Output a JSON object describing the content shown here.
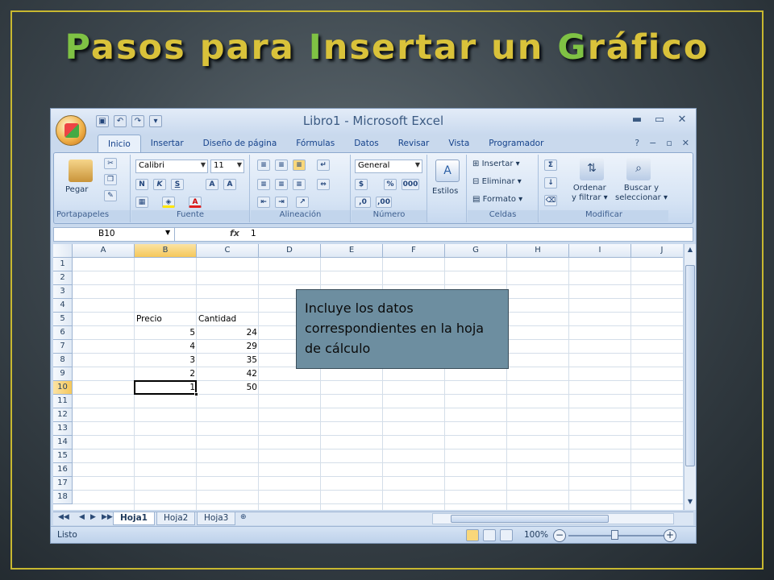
{
  "slide": {
    "title": "Pasos para Insertar un Gráfico",
    "callout": "Incluye los datos correspondientes en la hoja de cálculo"
  },
  "excel": {
    "window_title": "Libro1 - Microsoft Excel",
    "tabs": [
      "Inicio",
      "Insertar",
      "Diseño de página",
      "Fórmulas",
      "Datos",
      "Revisar",
      "Vista",
      "Programador"
    ],
    "active_tab": "Inicio",
    "ribbon": {
      "portapapeles": {
        "label": "Portapapeles",
        "pegar": "Pegar"
      },
      "fuente": {
        "label": "Fuente",
        "font": "Calibri",
        "size": "11"
      },
      "alineacion": {
        "label": "Alineación"
      },
      "numero": {
        "label": "Número",
        "format": "General"
      },
      "estilos": {
        "label": "Estilos"
      },
      "celdas": {
        "label": "Celdas",
        "insertar": "Insertar",
        "eliminar": "Eliminar",
        "formato": "Formato"
      },
      "modificar": {
        "label": "Modificar",
        "ordenar": "Ordenar",
        "ordenar2": "y filtrar",
        "buscar": "Buscar y",
        "buscar2": "seleccionar"
      }
    },
    "name_box": "B10",
    "fx": "fx",
    "formula_value": "1",
    "columns": [
      "A",
      "B",
      "C",
      "D",
      "E",
      "F",
      "G",
      "H",
      "I",
      "J"
    ],
    "rows": [
      "1",
      "2",
      "3",
      "4",
      "5",
      "6",
      "7",
      "8",
      "9",
      "10",
      "11",
      "12",
      "13",
      "14",
      "15",
      "16",
      "17",
      "18"
    ],
    "table": {
      "header_b": "Precio",
      "header_c": "Cantidad",
      "precio": [
        "5",
        "4",
        "3",
        "2",
        "1"
      ],
      "cantidad": [
        "24",
        "29",
        "35",
        "42",
        "50"
      ]
    },
    "sheets": [
      "Hoja1",
      "Hoja2",
      "Hoja3"
    ],
    "active_sheet": "Hoja1",
    "status": "Listo",
    "zoom": "100%"
  }
}
